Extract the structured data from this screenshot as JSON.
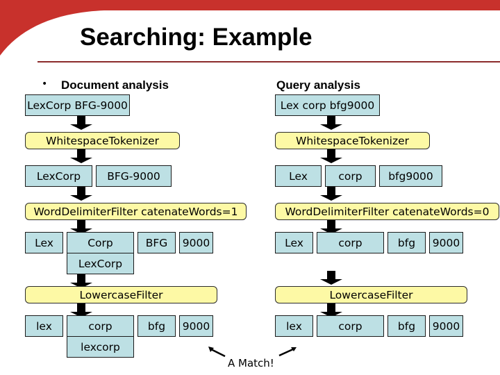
{
  "slide": {
    "title": "Searching: Example",
    "bullet": "•",
    "accent_color": "#c8312c"
  },
  "document": {
    "heading": "Document analysis",
    "input": "LexCorp BFG-9000",
    "tokenizer": "WhitespaceTokenizer",
    "tokens_after_tokenizer": [
      "LexCorp",
      "BFG-9000"
    ],
    "word_delimiter": "WordDelimiterFilter catenateWords=1",
    "tokens_after_wdf": [
      "Lex",
      "Corp",
      "BFG",
      "9000"
    ],
    "catenated_after_wdf": "LexCorp",
    "lowercase": "LowercaseFilter",
    "tokens_after_lowercase": [
      "lex",
      "corp",
      "bfg",
      "9000"
    ],
    "catenated_after_lowercase": "lexcorp"
  },
  "query": {
    "heading": "Query analysis",
    "input": "Lex corp bfg9000",
    "tokenizer": "WhitespaceTokenizer",
    "tokens_after_tokenizer": [
      "Lex",
      "corp",
      "bfg9000"
    ],
    "word_delimiter": "WordDelimiterFilter catenateWords=0",
    "tokens_after_wdf": [
      "Lex",
      "corp",
      "bfg",
      "9000"
    ],
    "lowercase": "LowercaseFilter",
    "tokens_after_lowercase": [
      "lex",
      "corp",
      "bfg",
      "9000"
    ]
  },
  "annotation": "A Match!"
}
